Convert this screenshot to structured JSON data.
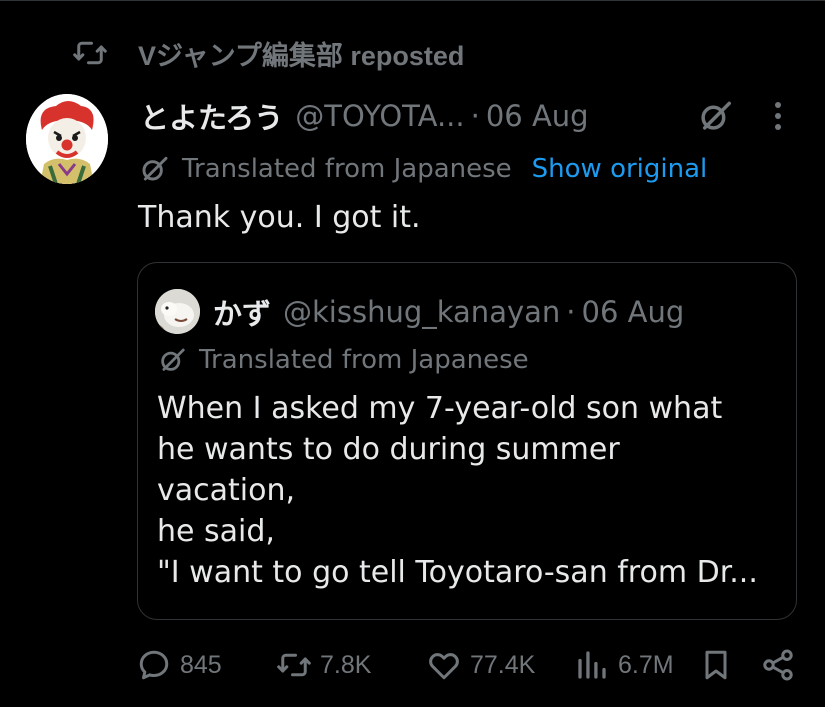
{
  "repost": {
    "text": "Vジャンプ編集部 reposted",
    "icon": "repost-icon"
  },
  "post": {
    "author_name": "とよたろう",
    "author_handle": "@TOYOTA...",
    "separator": "·",
    "date": "06 Aug",
    "translated_label": "Translated from Japanese",
    "show_original": "Show original",
    "text": "Thank you. I got it."
  },
  "quote": {
    "author_name": "かず",
    "author_handle": "@kisshug_kanayan",
    "separator": "·",
    "date": "06 Aug",
    "translated_label": "Translated from Japanese",
    "lines": [
      "When I asked my 7-year-old son what",
      "he wants to do during summer",
      "vacation,",
      "he said,",
      "\"I want to go tell Toyotaro-san from Dr..."
    ]
  },
  "actions": {
    "replies": "845",
    "reposts": "7.8K",
    "likes": "77.4K",
    "views": "6.7M"
  },
  "colors": {
    "background": "#000000",
    "text": "#e7e9ea",
    "muted": "#71767b",
    "link": "#1d9bf0",
    "border": "#2f3336"
  }
}
